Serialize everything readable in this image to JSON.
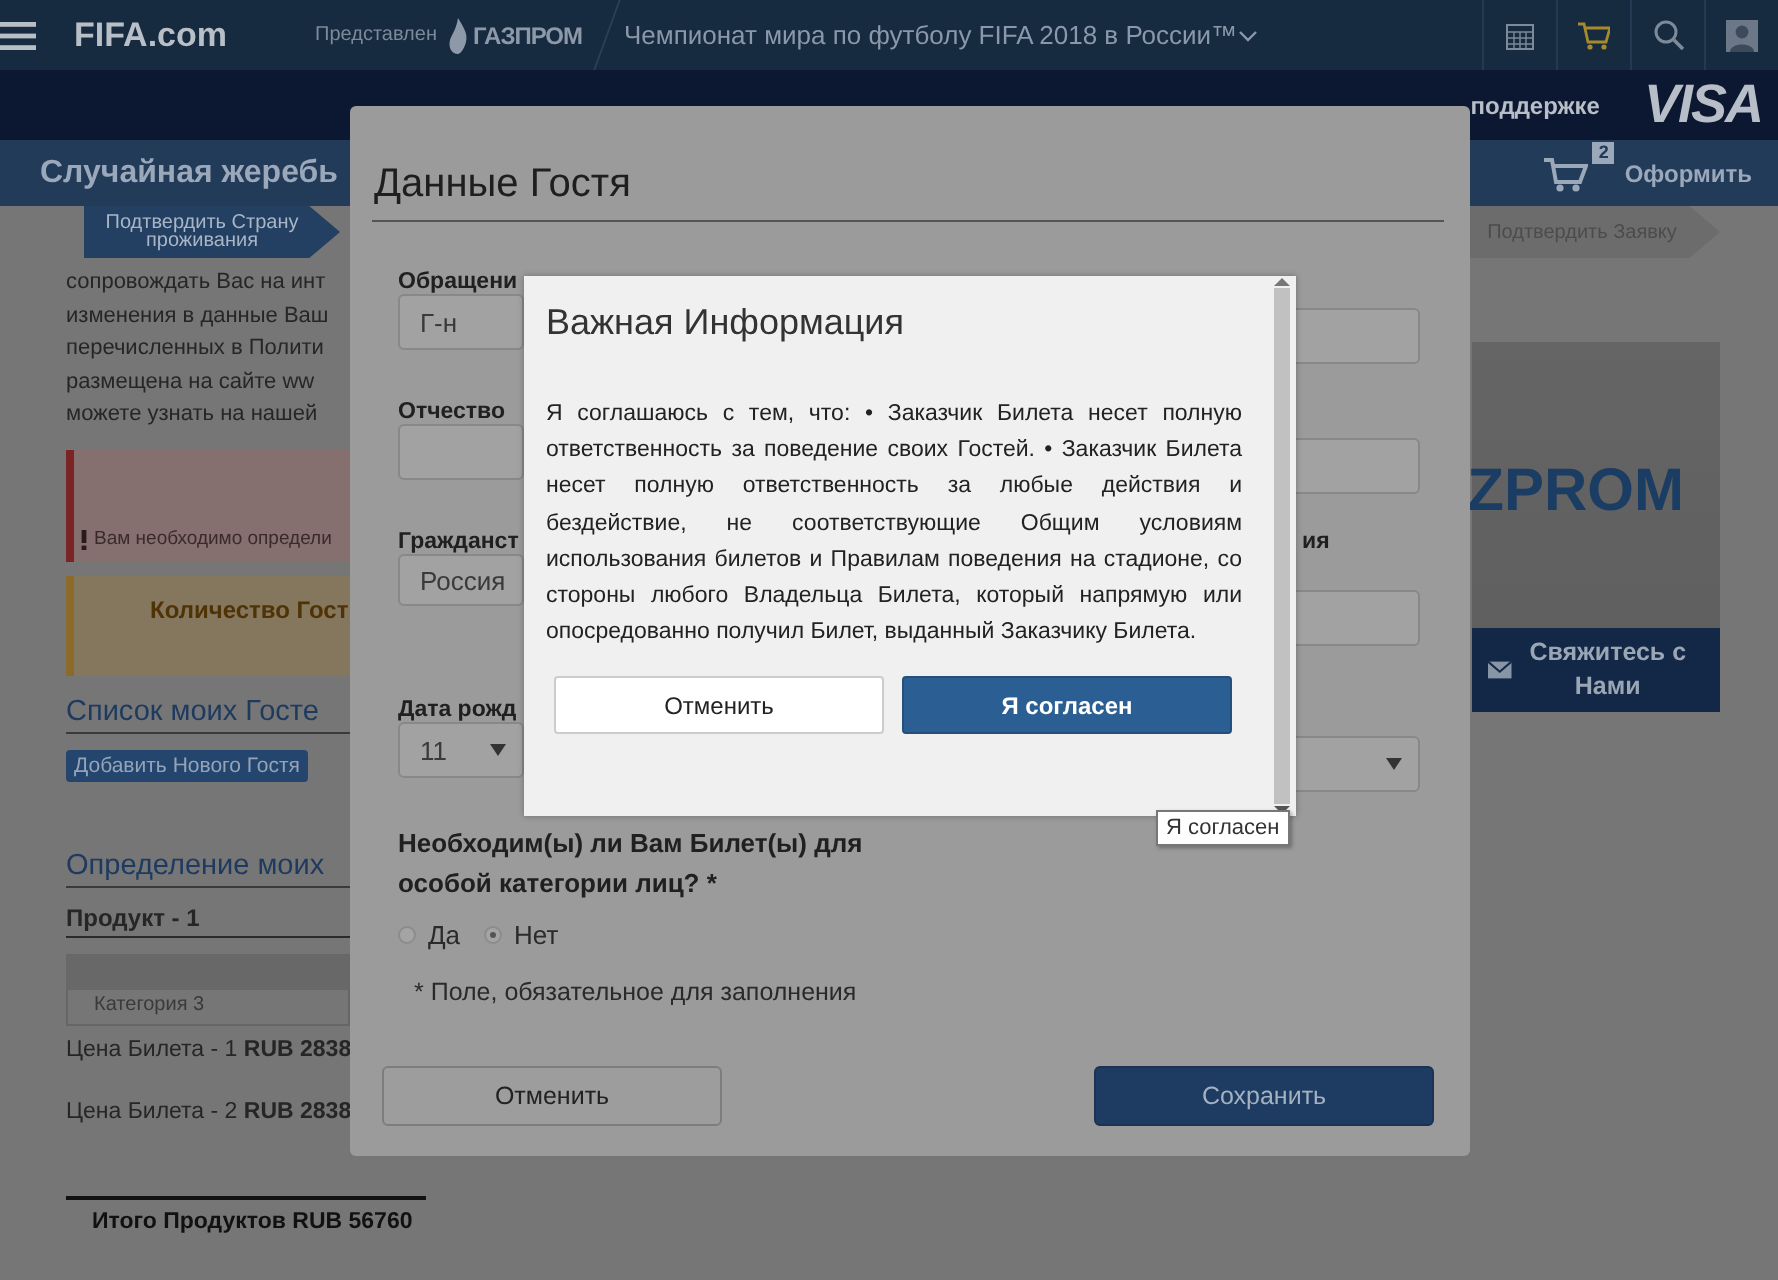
{
  "top_bar": {
    "logo": "FIFA.com",
    "presented_by": "Представлен",
    "sponsor": "ГАЗПРОМ",
    "title": "Чемпионат мира по футболу FIFA 2018 в России™"
  },
  "sponsor_bar": {
    "support_link": "поддержке",
    "partner": "VISA"
  },
  "page_header": {
    "title": "Случайная жеребь",
    "cart_count": "2",
    "checkout": "Оформить"
  },
  "steps": [
    {
      "label": "Подтвердить Страну проживания",
      "selected": true
    },
    {
      "label": "Подтвердить Заявку",
      "selected": false
    }
  ],
  "content": {
    "paragraph_lines": [
      "сопровождать Вас на инт",
      "изменения в данные Ваш",
      "перечисленных в Полити",
      "размещена на сайте ww",
      "можете узнать на нашей"
    ],
    "alert": "Вам необходимо определи",
    "notice": "Количество Гост",
    "guests_heading": "Список моих Госте",
    "add_guest_button": "Добавить Нового Гостя",
    "tickets_heading": "Определение моих",
    "product": "Продукт - 1",
    "category": "Категория 3",
    "prices": [
      "Цена Билета - 1 **RUB 2838**",
      "Цена Билета - 2 **RUB 2838**"
    ],
    "total": "Итого Продуктов RUB 56760"
  },
  "sidebar": {
    "banner_text": "ZPROM",
    "contact_button": "Свяжитесь с Нами"
  },
  "guest_dialog": {
    "title": "Данные Гостя",
    "left_fields": [
      {
        "label": "Обращени",
        "value": "Г-н",
        "kind": "input"
      },
      {
        "label": "Отчество",
        "kind": "input"
      },
      {
        "label": "Гражданст",
        "value": "Россия",
        "kind": "input"
      },
      {
        "label": "Дата рожд",
        "value": "11",
        "kind": "select"
      }
    ],
    "right_fields": [
      {
        "kind": "input"
      },
      {
        "kind": "input"
      },
      {
        "label": "ия",
        "kind": "input"
      },
      {
        "kind": "select"
      }
    ],
    "question": "Необходим(ы) ли Вам Билет(ы) для особой категории лиц? *",
    "options": [
      {
        "label": "Да",
        "selected": false
      },
      {
        "label": "Нет",
        "selected": true
      }
    ],
    "required_note": "* Поле, обязательное для заполнения",
    "buttons": [
      {
        "label": "Отменить",
        "kind": "secondary"
      },
      {
        "label": "Сохранить",
        "kind": "primary"
      }
    ]
  },
  "info_dialog": {
    "title": "Важная Информация",
    "text": "Я соглашаюсь с тем, что: • Заказчик Билета несет полную ответственность за поведение своих Гостей. • Заказчик Билета несет полную ответственность за любые действия и бездействие, не соответствующие Общим условиям использования билетов и Правилам поведения на стадионе, со стороны любого Владельца Билета, который напрямую или опосредованно получил Билет, выданный Заказчику Билета.",
    "buttons": [
      {
        "label": "Отменить",
        "kind": "secondary"
      },
      {
        "label": "Я согласен",
        "kind": "primary"
      }
    ]
  },
  "tooltip": "Я согласен"
}
